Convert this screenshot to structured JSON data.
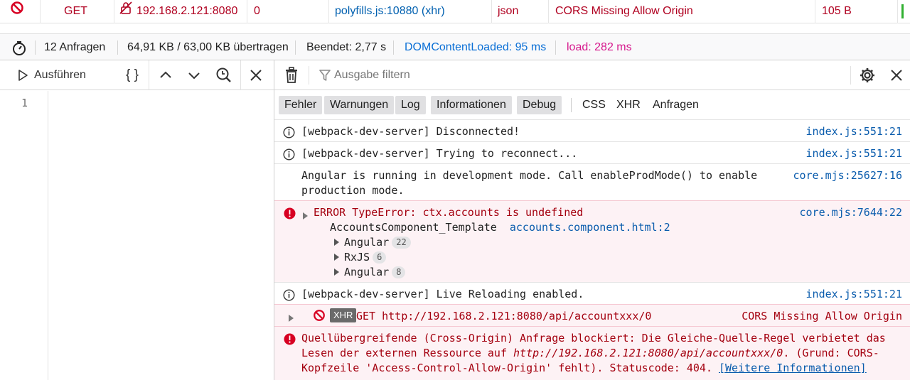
{
  "network_row": {
    "method": "GET",
    "host": "192.168.2.121:8080",
    "status": "0",
    "initiator": "polyfills.js:10880",
    "initiator_type": "(xhr)",
    "type": "json",
    "transferred": "CORS Missing Allow Origin",
    "size": "105 B"
  },
  "summary": {
    "requests": "12 Anfragen",
    "transferred": "64,91 KB / 63,00 KB übertragen",
    "finished": "Beendet: 2,77 s",
    "dom_content_loaded": "DOMContentLoaded: 95 ms",
    "load": "load: 282 ms"
  },
  "editor": {
    "run_label": "Ausführen",
    "pretty_label": "{ }",
    "line_number": "1"
  },
  "console": {
    "filter_placeholder": "Ausgabe filtern",
    "levels": [
      "Fehler",
      "Warnungen",
      "Log",
      "Informationen",
      "Debug"
    ],
    "extra_filters": [
      "CSS",
      "XHR",
      "Anfragen"
    ],
    "messages": [
      {
        "kind": "info",
        "text": "[webpack-dev-server] Disconnected!",
        "source": "index.js:551:21"
      },
      {
        "kind": "info",
        "text": "[webpack-dev-server] Trying to reconnect...",
        "source": "index.js:551:21"
      },
      {
        "kind": "log",
        "text_line1": "Angular is running in development mode. Call enableProdMode() to enable",
        "text_line2": "production mode.",
        "source": "core.mjs:25627:16"
      },
      {
        "kind": "error",
        "text": "ERROR TypeError: ctx.accounts is undefined",
        "source": "core.mjs:7644:22",
        "stack_fn": "AccountsComponent_Template",
        "stack_link": "accounts.component.html:2",
        "groups": [
          {
            "name": "Angular",
            "count": "22"
          },
          {
            "name": "RxJS",
            "count": "6"
          },
          {
            "name": "Angular",
            "count": "8"
          }
        ]
      },
      {
        "kind": "info",
        "text": "[webpack-dev-server] Live Reloading enabled.",
        "source": "index.js:551:21"
      },
      {
        "kind": "xhr-error",
        "tag": "XHR",
        "method": "GET",
        "url": "http://192.168.2.121:8080/api/accountxxx/0",
        "status": "CORS Missing Allow Origin"
      },
      {
        "kind": "error",
        "line1": "Quellübergreifende (Cross-Origin) Anfrage blockiert: Die Gleiche-Quelle-Regel verbietet das",
        "line2_pre": "Lesen der externen Ressource auf ",
        "line2_url": "http://192.168.2.121:8080/api/accountxxx/0",
        "line2_post": ". (Grund: CORS-",
        "line3": "Kopfzeile 'Access-Control-Allow-Origin' fehlt). Statuscode: 404. ",
        "more_info": "[Weitere Informationen]"
      }
    ]
  },
  "colors": {
    "error_text": "#a4000f",
    "error_bg": "#fdf2f5",
    "link": "#0a5cad",
    "load": "#d6188c",
    "dcl": "#0a6fd6"
  }
}
